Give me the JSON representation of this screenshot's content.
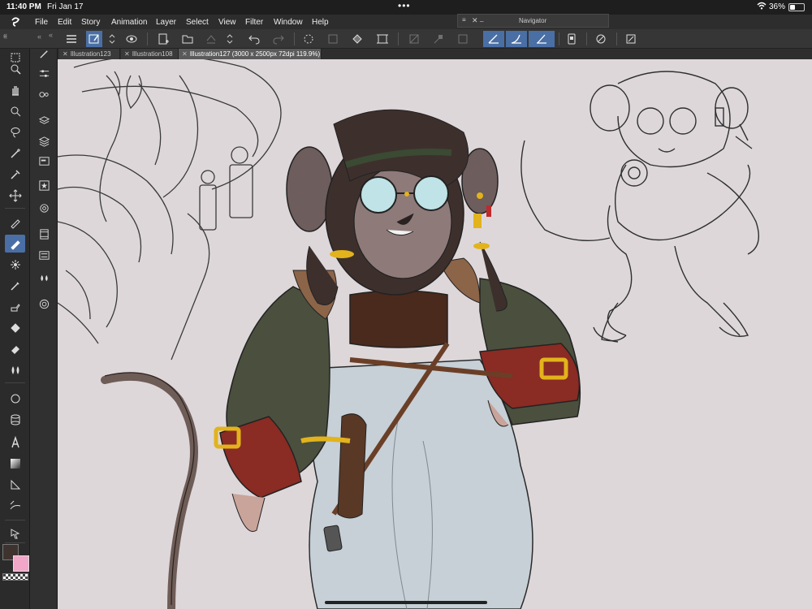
{
  "status": {
    "time": "11:40 PM",
    "date": "Fri Jan 17",
    "battery": "36%",
    "battery_level": 0.36
  },
  "menu": {
    "items": [
      "File",
      "Edit",
      "Story",
      "Animation",
      "Layer",
      "Select",
      "View",
      "Filter",
      "Window",
      "Help"
    ]
  },
  "navigator": {
    "title": "Navigator",
    "mini": "_"
  },
  "tabs": [
    {
      "label": "Illustration123",
      "active": false
    },
    {
      "label": "Illustration108",
      "active": false
    },
    {
      "label": "Illustration127 (3000 x 2500px 72dpi 119.9%)",
      "active": true
    }
  ],
  "colors": {
    "main": "#3f3330",
    "sub": "#f2a6c8",
    "accent": "#4a6fa5",
    "canvas": "#ddd7da"
  },
  "tools": [
    "selection-icon",
    "zoom-icon",
    "hand-icon",
    "rotate-icon",
    "lasso-icon",
    "magic-wand-icon",
    "eyedropper-icon",
    "move-icon",
    "pen-icon",
    "pencil-icon",
    "brush-icon",
    "airbrush-icon",
    "decoration-icon",
    "eraser-icon",
    "blend-icon",
    "fill-icon",
    "figure-icon",
    "frame-icon",
    "text-icon",
    "gradient-icon",
    "ruler-icon",
    "correct-line-icon",
    "object-icon"
  ]
}
